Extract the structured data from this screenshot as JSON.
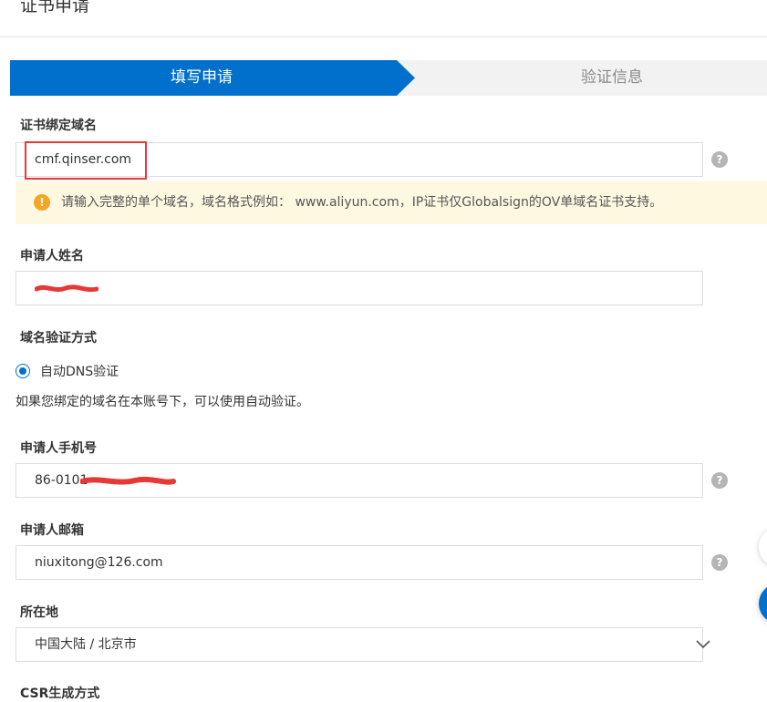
{
  "page": {
    "title": "证书申请"
  },
  "steps": [
    {
      "label": "填写申请",
      "active": true
    },
    {
      "label": "验证信息",
      "active": false
    }
  ],
  "form": {
    "domain": {
      "label": "证书绑定域名",
      "value": "cmf.qinser.com",
      "help_icon": "question-icon"
    },
    "notice": {
      "icon": "warning-icon",
      "text": "请输入完整的单个域名，域名格式例如： www.aliyun.com，IP证书仅Globalsign的OV单域名证书支持。"
    },
    "applicant_name": {
      "label": "申请人姓名"
    },
    "verify_method": {
      "label": "域名验证方式",
      "option": "自动DNS验证",
      "hint": "如果您绑定的域名在本账号下，可以使用自动验证。"
    },
    "phone": {
      "label": "申请人手机号",
      "value": "86-0101",
      "help_icon": "question-icon"
    },
    "email": {
      "label": "申请人邮箱",
      "value": "niuxitong@126.com",
      "help_icon": "question-icon"
    },
    "location": {
      "label": "所在地",
      "value": "中国大陆 / 北京市"
    },
    "csr": {
      "label": "CSR生成方式"
    }
  },
  "colors": {
    "accent": "#0070cc",
    "highlight": "#e53935",
    "notice_bg": "#fff8e1",
    "warning": "#f5a623"
  }
}
